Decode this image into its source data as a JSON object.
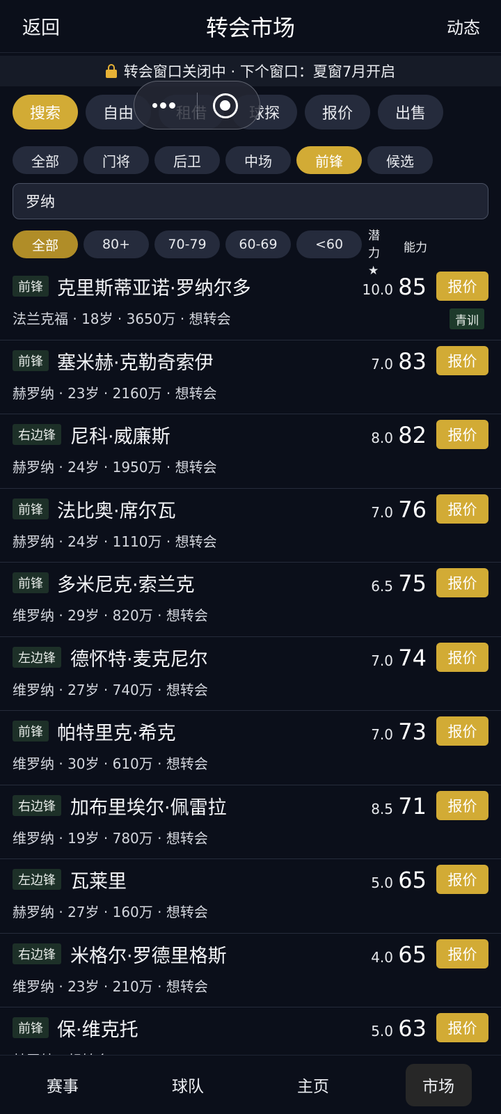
{
  "header": {
    "back": "返回",
    "title": "转会市场",
    "right": "动态"
  },
  "notice": {
    "text": "转会窗口关闭中 · 下个窗口：夏窗7月开启"
  },
  "tabs": [
    {
      "label": "搜索",
      "active": true
    },
    {
      "label": "自由"
    },
    {
      "label": "租借"
    },
    {
      "label": "球探"
    },
    {
      "label": "报价"
    },
    {
      "label": "出售"
    }
  ],
  "positions": [
    {
      "label": "全部"
    },
    {
      "label": "门将"
    },
    {
      "label": "后卫"
    },
    {
      "label": "中场"
    },
    {
      "label": "前锋",
      "active": true
    },
    {
      "label": "候选"
    }
  ],
  "search": {
    "value": "罗纳"
  },
  "ratings": [
    {
      "label": "全部",
      "active": true
    },
    {
      "label": "80+"
    },
    {
      "label": "70-79"
    },
    {
      "label": "60-69"
    },
    {
      "label": "<60"
    }
  ],
  "columns": {
    "potential": "潜力★",
    "ability": "能力"
  },
  "offer_label": "报价",
  "players": [
    {
      "pos": "前锋",
      "name": "克里斯蒂亚诺·罗纳尔多",
      "club": "法兰克福",
      "age": "18岁",
      "value": "3650万",
      "status": "想转会",
      "potential": "10.0",
      "ability": "85",
      "tag": "青训"
    },
    {
      "pos": "前锋",
      "name": "塞米赫·克勒奇索伊",
      "club": "赫罗纳",
      "age": "23岁",
      "value": "2160万",
      "status": "想转会",
      "potential": "7.0",
      "ability": "83"
    },
    {
      "pos": "右边锋",
      "name": "尼科·威廉斯",
      "club": "赫罗纳",
      "age": "24岁",
      "value": "1950万",
      "status": "想转会",
      "potential": "8.0",
      "ability": "82"
    },
    {
      "pos": "前锋",
      "name": "法比奥·席尔瓦",
      "club": "赫罗纳",
      "age": "24岁",
      "value": "1110万",
      "status": "想转会",
      "potential": "7.0",
      "ability": "76"
    },
    {
      "pos": "前锋",
      "name": "多米尼克·索兰克",
      "club": "维罗纳",
      "age": "29岁",
      "value": "820万",
      "status": "想转会",
      "potential": "6.5",
      "ability": "75"
    },
    {
      "pos": "左边锋",
      "name": "德怀特·麦克尼尔",
      "club": "维罗纳",
      "age": "27岁",
      "value": "740万",
      "status": "想转会",
      "potential": "7.0",
      "ability": "74"
    },
    {
      "pos": "前锋",
      "name": "帕特里克·希克",
      "club": "维罗纳",
      "age": "30岁",
      "value": "610万",
      "status": "想转会",
      "potential": "7.0",
      "ability": "73"
    },
    {
      "pos": "右边锋",
      "name": "加布里埃尔·佩雷拉",
      "club": "维罗纳",
      "age": "19岁",
      "value": "780万",
      "status": "想转会",
      "potential": "8.5",
      "ability": "71"
    },
    {
      "pos": "左边锋",
      "name": "瓦莱里",
      "club": "赫罗纳",
      "age": "27岁",
      "value": "160万",
      "status": "想转会",
      "potential": "5.0",
      "ability": "65"
    },
    {
      "pos": "右边锋",
      "name": "米格尔·罗德里格斯",
      "club": "维罗纳",
      "age": "23岁",
      "value": "210万",
      "status": "想转会",
      "potential": "4.0",
      "ability": "65"
    },
    {
      "pos": "前锋",
      "name": "保·维克托",
      "club": "赫罗纳",
      "age": "",
      "value": "",
      "status": "想转会",
      "potential": "5.0",
      "ability": "63"
    }
  ],
  "bottom_nav": [
    {
      "label": "赛事"
    },
    {
      "label": "球队"
    },
    {
      "label": "主页"
    },
    {
      "label": "市场",
      "active": true
    }
  ],
  "colors": {
    "accent": "#d2ab35",
    "background": "#0b0f1a",
    "chip": "#252b3c",
    "badge": "#1d3028"
  }
}
